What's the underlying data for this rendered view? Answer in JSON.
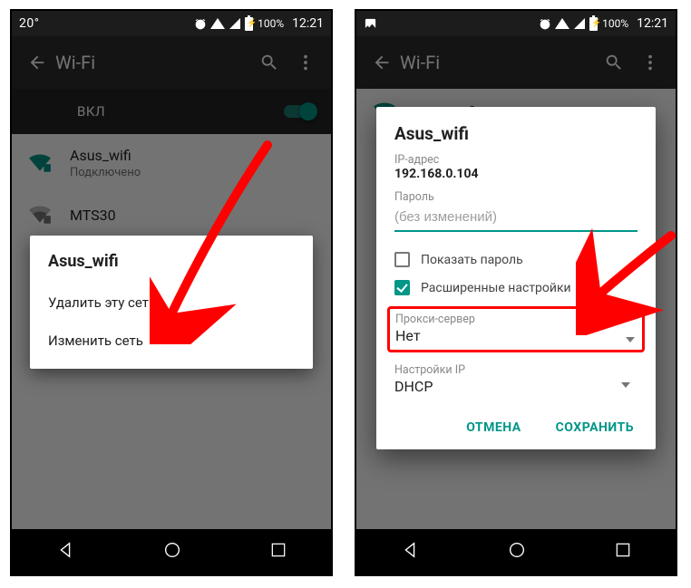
{
  "status": {
    "temperature": "20°",
    "battery_pct": "100%",
    "clock": "12:21"
  },
  "wifi": {
    "title": "Wi-Fi",
    "toggle_label": "ВКЛ",
    "networks": [
      {
        "name": "Asus_wifi",
        "subtitle": "Подключено"
      },
      {
        "name": "MTS30",
        "subtitle": ""
      }
    ],
    "context_menu": {
      "title": "Asus_wifi",
      "forget": "Удалить эту сеть",
      "modify": "Изменить сеть"
    },
    "edit_dialog": {
      "title": "Asus_wifi",
      "ip_label": "IP-адрес",
      "ip_value": "192.168.0.104",
      "password_label": "Пароль",
      "password_placeholder": "(без изменений)",
      "show_password": "Показать пароль",
      "show_password_checked": false,
      "advanced": "Расширенные настройки",
      "advanced_checked": true,
      "proxy_label": "Прокси-сервер",
      "proxy_value": "Нет",
      "ip_settings_label": "Настройки IP",
      "ip_settings_value": "DHCP",
      "cancel": "ОТМЕНА",
      "save": "СОХРАНИТЬ"
    }
  }
}
